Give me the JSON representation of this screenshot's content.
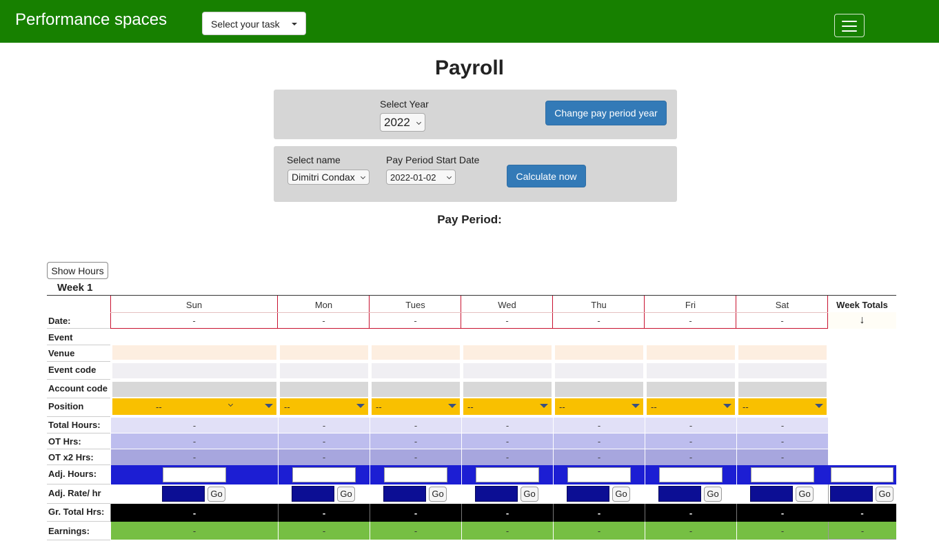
{
  "navbar": {
    "brand": "Performance spaces",
    "task_select": "Select your task",
    "menu_icon": "hamburger-icon"
  },
  "page": {
    "title": "Payroll",
    "year_label": "Select Year",
    "year_value": "2022",
    "change_year_button": "Change pay period year",
    "name_label": "Select name",
    "name_value": "Dimitri Condax",
    "start_label": "Pay Period Start Date",
    "start_value": "2022-01-02",
    "calculate_button": "Calculate now",
    "pay_period_label": "Pay Period:",
    "show_hours_button": "Show Hours",
    "week_title": "Week 1"
  },
  "table": {
    "days": [
      "Sun",
      "Mon",
      "Tues",
      "Wed",
      "Thu",
      "Fri",
      "Sat"
    ],
    "week_totals_label": "Week Totals",
    "week_totals_arrow": "↓",
    "row_labels": {
      "date": "Date:",
      "event": "Event",
      "venue": "Venue",
      "event_code": "Event code",
      "account_code": "Account code",
      "position": "Position",
      "total_hours": "Total Hours:",
      "ot_hrs": "OT Hrs:",
      "ot_x2_hrs": "OT x2 Hrs:",
      "adj_hours": "Adj. Hours:",
      "adj_rate": "Adj. Rate/ hr",
      "gr_total": "Gr. Total Hrs:",
      "earnings": "Earnings:"
    },
    "empty_value": "-",
    "position_value": "--",
    "go_label": "Go",
    "colors": {
      "venue": "#fdeee0",
      "event_code": "#f0eff3",
      "account_code": "#d8d8d8",
      "position": "#f9c000",
      "total_hours": "#e1e0f7",
      "ot_hrs": "#bdbdee",
      "ot_x2_hrs": "#a7a6de",
      "adj_hours": "#1c1ed3",
      "adj_rate": "#0c0e94",
      "gr_total": "#000000",
      "earnings": "#76bf43"
    }
  }
}
